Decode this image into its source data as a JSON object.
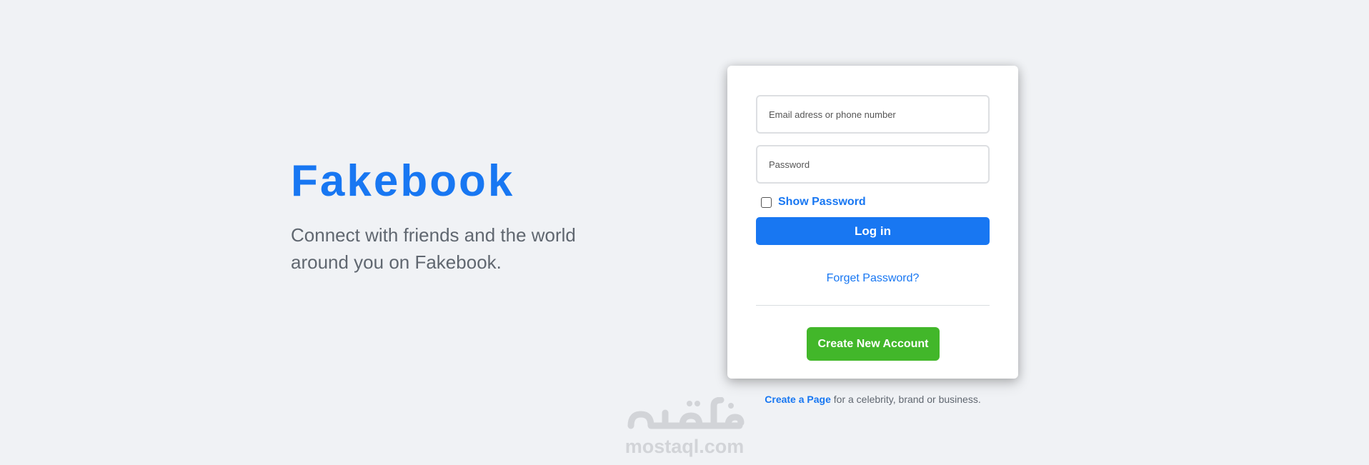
{
  "colors": {
    "brand_blue": "#1877f2",
    "green": "#42b72a",
    "background": "#f0f2f5",
    "muted_text": "#606770"
  },
  "hero": {
    "brand": "Fakebook",
    "tagline": "Connect with friends and the world around you on Fakebook."
  },
  "login": {
    "email_placeholder": "Email adress or phone number",
    "password_placeholder": "Password",
    "show_password_label": "Show Password",
    "login_button": "Log in",
    "forgot_link": "Forget Password?",
    "create_button": "Create New Account"
  },
  "footer": {
    "create_page_link": "Create a Page",
    "create_page_rest": " for a celebrity, brand or business."
  },
  "watermark": {
    "text": "mostaql.com",
    "logo_icon": "mostaql-logo-icon"
  }
}
